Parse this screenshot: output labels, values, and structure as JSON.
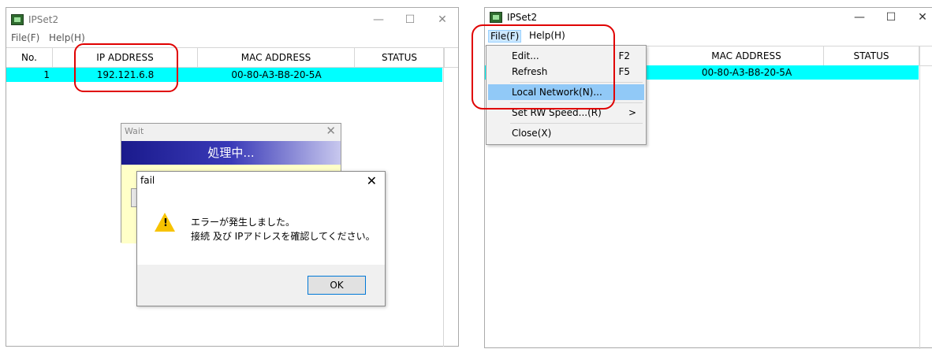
{
  "left_window": {
    "title": "IPSet2",
    "controls": {
      "minimize": "—",
      "maximize": "☐",
      "close": "✕"
    },
    "menu": [
      "File(F)",
      "Help(H)"
    ],
    "columns": [
      "No.",
      "IP ADDRESS",
      "MAC ADDRESS",
      "STATUS"
    ],
    "rows": [
      {
        "no": "1",
        "ip": "192.121.6.8",
        "mac": "00-80-A3-B8-20-5A",
        "status": ""
      }
    ]
  },
  "wait_dialog": {
    "title": "Wait",
    "close": "✕",
    "banner": "処理中..."
  },
  "fail_dialog": {
    "title": "fail",
    "close": "✕",
    "message_line1": "エラーが発生しました。",
    "message_line2": "接続 及び IPアドレスを確認してください。",
    "ok_label": "OK",
    "icon": "warning-icon"
  },
  "right_window": {
    "title": "IPSet2",
    "controls": {
      "minimize": "—",
      "maximize": "☐",
      "close": "✕"
    },
    "menu": [
      "File(F)",
      "Help(H)"
    ],
    "columns": [
      "MAC ADDRESS",
      "STATUS"
    ],
    "rows": [
      {
        "mac": "00-80-A3-B8-20-5A",
        "status": ""
      }
    ],
    "file_menu": [
      {
        "label": "Edit...",
        "shortcut": "F2"
      },
      {
        "label": "Refresh",
        "shortcut": "F5"
      },
      {
        "label": "Local Network(N)...",
        "shortcut": ""
      },
      {
        "label": "Set RW Speed...(R)",
        "shortcut": ">"
      },
      {
        "label": "Close(X)",
        "shortcut": ""
      }
    ]
  },
  "colors": {
    "row_highlight": "#00ffff",
    "callout": "#e00000",
    "menu_selected": "#91c9f7",
    "warning": "#f7c300"
  }
}
